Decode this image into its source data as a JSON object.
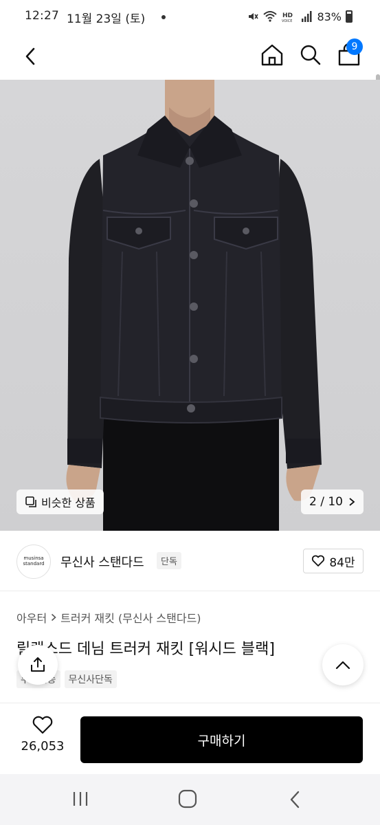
{
  "status_bar": {
    "time": "12:27",
    "date": "11월 23일 (토)",
    "battery": "83%",
    "icons": [
      "mute-icon",
      "wifi-icon",
      "hd-voice-icon",
      "signal-icon",
      "battery-icon"
    ]
  },
  "header": {
    "cart_count": "9",
    "icons": [
      "back-icon",
      "home-icon",
      "search-icon",
      "cart-icon"
    ]
  },
  "gallery": {
    "similar_label": "비슷한 상품",
    "page_indicator": "2 / 10"
  },
  "brand": {
    "logo_line1": "musinsa",
    "logo_line2": "standard",
    "name": "무신사 스탠다드",
    "badge": "단독",
    "like_count": "84만"
  },
  "product": {
    "category": "아우터",
    "subcategory": "트러커 재킷 (무신사 스탠다드)",
    "title": "릴랙스드 데님 트러커 재킷 [워시드 블랙]",
    "tags": [
      "무료배송",
      "무신사단독"
    ]
  },
  "actions": {
    "like_count": "26,053",
    "buy_label": "구매하기"
  },
  "colors": {
    "badge_blue": "#0078ff",
    "buy_button": "#000000"
  }
}
